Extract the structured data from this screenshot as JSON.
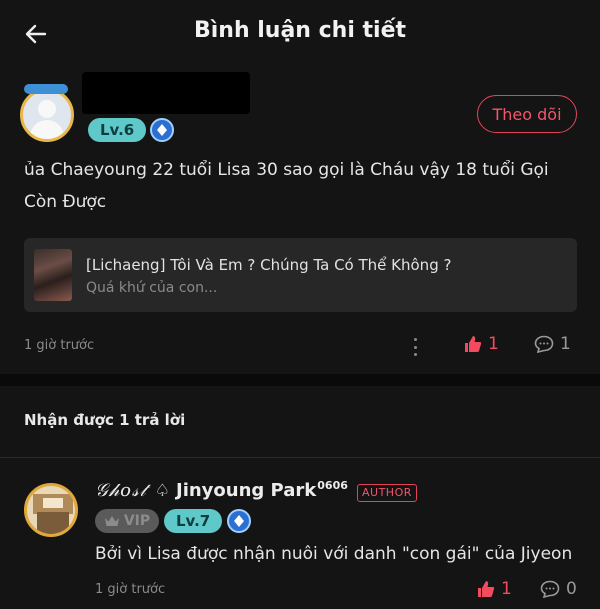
{
  "header": {
    "title": "Bình luận chi tiết",
    "back_icon": "arrow-left-icon"
  },
  "comment": {
    "level": "Lv.6",
    "follow_label": "Theo dõi",
    "text": "ủa Chaeyoung 22 tuổi Lisa 30 sao gọi là Cháu vậy 18 tuổi Gọi Còn Được",
    "story": {
      "title": "[Lichaeng] Tôi Và Em ? Chúng Ta Có Thể Không ?",
      "excerpt": "Quá khứ của con..."
    },
    "time": "1 giờ trước",
    "likes": "1",
    "replies": "1"
  },
  "replies_section": {
    "heading": "Nhận được 1 trả lời"
  },
  "reply": {
    "name_styled": "𝒢𝒽𝑜𝓈𝓉",
    "spade": "♤",
    "name": "Jinyoung Park",
    "name_suffix": "0606",
    "author_label": "AUTHOR",
    "vip_label": "VIP",
    "level": "Lv.7",
    "text": "Bởi vì Lisa được nhận nuôi với danh \"con gái\" của Jiyeon",
    "time": "1 giờ trước",
    "likes": "1",
    "replies": "0"
  },
  "colors": {
    "accent": "#f24a5f",
    "level_badge": "#5fc8c8",
    "background": "#141414"
  }
}
